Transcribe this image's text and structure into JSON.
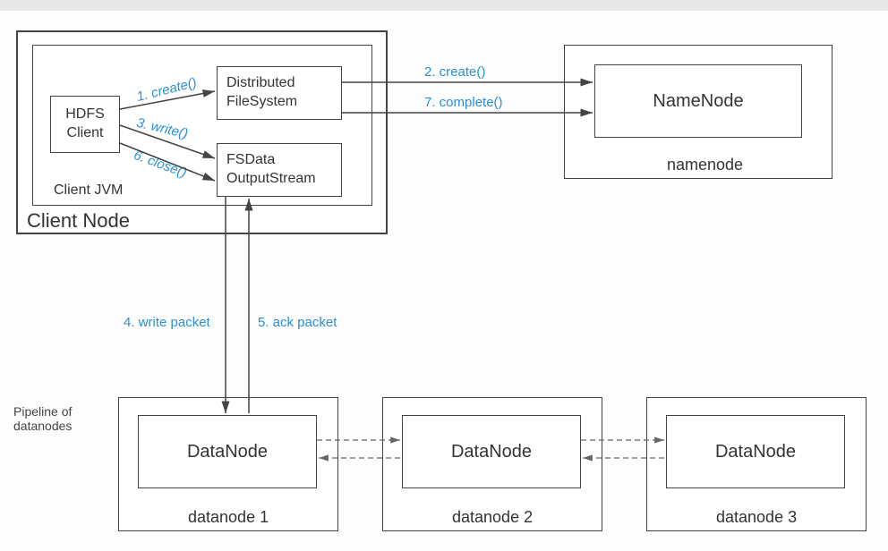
{
  "boxes": {
    "client_node": {
      "label": "Client Node"
    },
    "client_jvm": {
      "label": "Client JVM"
    },
    "hdfs_client": {
      "line1": "HDFS",
      "line2": "Client"
    },
    "distributed_fs": {
      "line1": "Distributed",
      "line2": "FileSystem"
    },
    "fsdata_out": {
      "line1": "FSData",
      "line2": "OutputStream"
    },
    "namenode_outer": {
      "label": "namenode"
    },
    "namenode_inner": {
      "label": "NameNode"
    },
    "datanode1_outer": {
      "label": "datanode 1"
    },
    "datanode1_inner": {
      "label": "DataNode"
    },
    "datanode2_outer": {
      "label": "datanode 2"
    },
    "datanode2_inner": {
      "label": "DataNode"
    },
    "datanode3_outer": {
      "label": "datanode 3"
    },
    "datanode3_inner": {
      "label": "DataNode"
    }
  },
  "edges": {
    "e1": "1. create()",
    "e2": "2. create()",
    "e3": "3. write()",
    "e4": "4. write packet",
    "e5": "5. ack packet",
    "e6": "6. close()",
    "e7": "7. complete()"
  },
  "side": {
    "pipeline": "Pipeline of datanodes"
  }
}
